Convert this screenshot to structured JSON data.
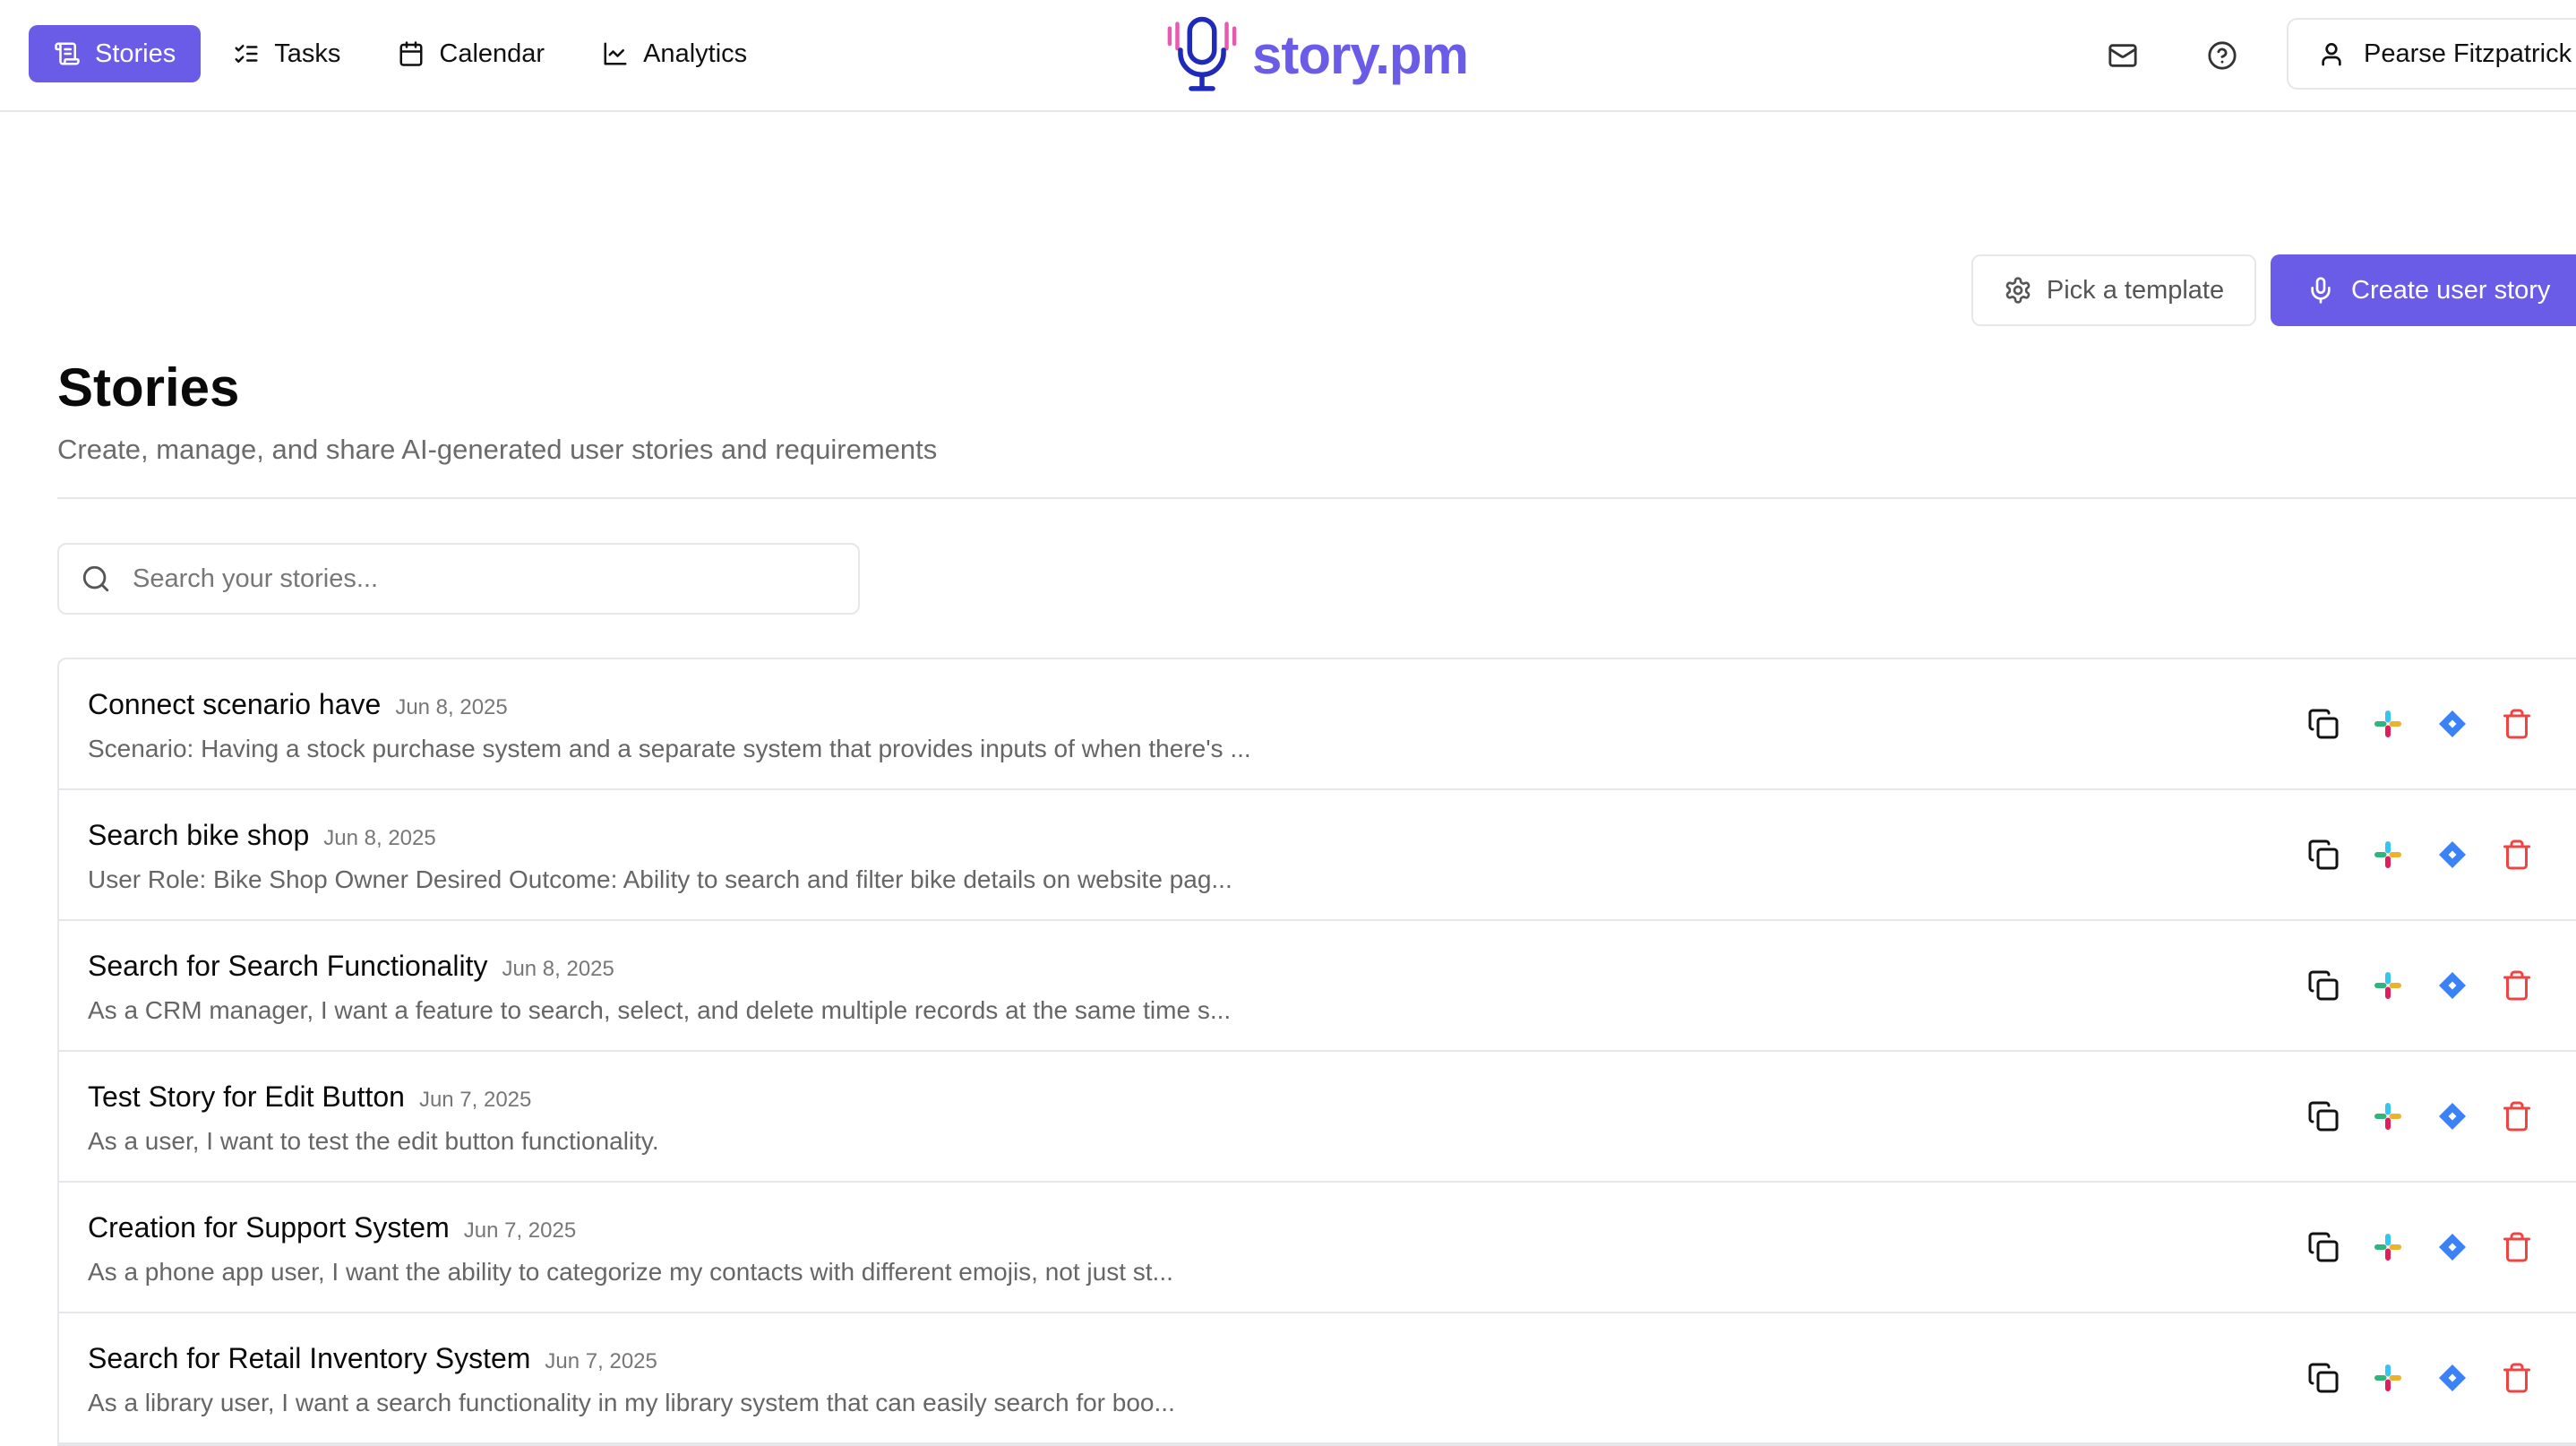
{
  "nav": {
    "items": [
      {
        "label": "Stories",
        "icon": "stories-icon",
        "active": true
      },
      {
        "label": "Tasks",
        "icon": "tasks-icon",
        "active": false
      },
      {
        "label": "Calendar",
        "icon": "calendar-icon",
        "active": false
      },
      {
        "label": "Analytics",
        "icon": "analytics-icon",
        "active": false
      }
    ],
    "brand": "story.pm",
    "user_name": "Pearse Fitzpatrick"
  },
  "header": {
    "title": "Stories",
    "subtitle": "Create, manage, and share AI-generated user stories and requirements",
    "pick_template_label": "Pick a template",
    "create_story_label": "Create user story"
  },
  "search": {
    "placeholder": "Search your stories...",
    "value": ""
  },
  "colors": {
    "accent": "#6b5ce7",
    "jira_blue": "#3b82f6",
    "delete_red": "#ef4444"
  },
  "stories": [
    {
      "title": "Connect scenario have",
      "date": "Jun 8, 2025",
      "description": "Scenario: Having a stock purchase system and a separate system that provides inputs of when there's ..."
    },
    {
      "title": "Search bike shop",
      "date": "Jun 8, 2025",
      "description": "User Role: Bike Shop Owner Desired Outcome: Ability to search and filter bike details on website pag..."
    },
    {
      "title": "Search for Search Functionality",
      "date": "Jun 8, 2025",
      "description": "As a CRM manager, I want a feature to search, select, and delete multiple records at the same time s..."
    },
    {
      "title": "Test Story for Edit Button",
      "date": "Jun 7, 2025",
      "description": "As a user, I want to test the edit button functionality."
    },
    {
      "title": "Creation for Support System",
      "date": "Jun 7, 2025",
      "description": "As a phone app user, I want the ability to categorize my contacts with different emojis, not just st..."
    },
    {
      "title": "Search for Retail Inventory System",
      "date": "Jun 7, 2025",
      "description": "As a library user, I want a search functionality in my library system that can easily search for boo..."
    }
  ]
}
